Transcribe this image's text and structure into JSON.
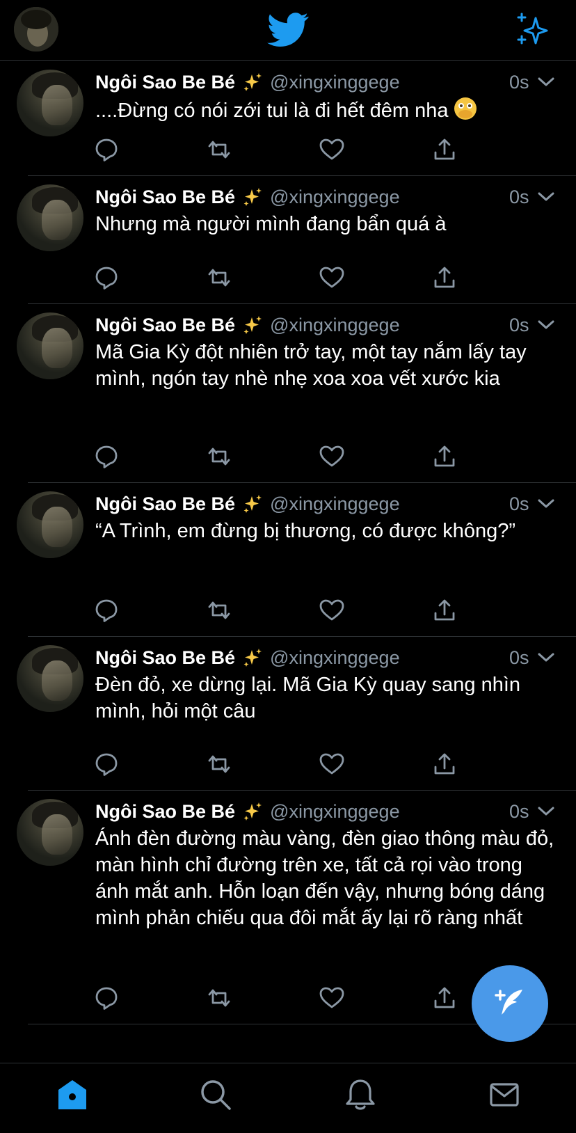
{
  "header": {
    "avatar_icon": "profile-avatar",
    "logo_icon": "twitter-bird-icon",
    "sparkle_icon": "sparkle-icon",
    "accent_color": "#1d9bf0"
  },
  "tweets": [
    {
      "name": "Ngôi Sao Be Bé",
      "handle": "@xingxinggege",
      "time": "0s",
      "text": "....Đừng có nói zới tui là đi hết đêm nha",
      "emoji": "face-with-open-eyes-and-hand-over-mouth"
    },
    {
      "name": "Ngôi Sao Be Bé",
      "handle": "@xingxinggege",
      "time": "0s",
      "text": "Nhưng mà người mình đang bẩn quá à"
    },
    {
      "name": "Ngôi Sao Be Bé",
      "handle": "@xingxinggege",
      "time": "0s",
      "text": "Mã Gia Kỳ đột nhiên trở tay, một tay nắm lấy tay mình, ngón tay nhè nhẹ xoa xoa vết xước kia"
    },
    {
      "name": "Ngôi Sao Be Bé",
      "handle": "@xingxinggege",
      "time": "0s",
      "text": "“A Trình, em đừng bị thương, có được không?”"
    },
    {
      "name": "Ngôi Sao Be Bé",
      "handle": "@xingxinggege",
      "time": "0s",
      "text": "Đèn đỏ, xe dừng lại. Mã Gia Kỳ quay sang nhìn mình, hỏi một câu"
    },
    {
      "name": "Ngôi Sao Be Bé",
      "handle": "@xingxinggege",
      "time": "0s",
      "text": "Ánh đèn đường màu vàng, đèn giao thông màu đỏ, màn hình chỉ đường trên xe, tất cả rọi vào trong ánh mắt anh. Hỗn loạn đến vậy, nhưng bóng dáng mình phản chiếu qua đôi mắt ấy lại rõ ràng nhất"
    }
  ],
  "bottom_nav": {
    "items": [
      "home-icon",
      "search-icon",
      "notifications-icon",
      "messages-icon"
    ],
    "active": "home-icon"
  },
  "fab_icon": "compose-tweet-icon"
}
